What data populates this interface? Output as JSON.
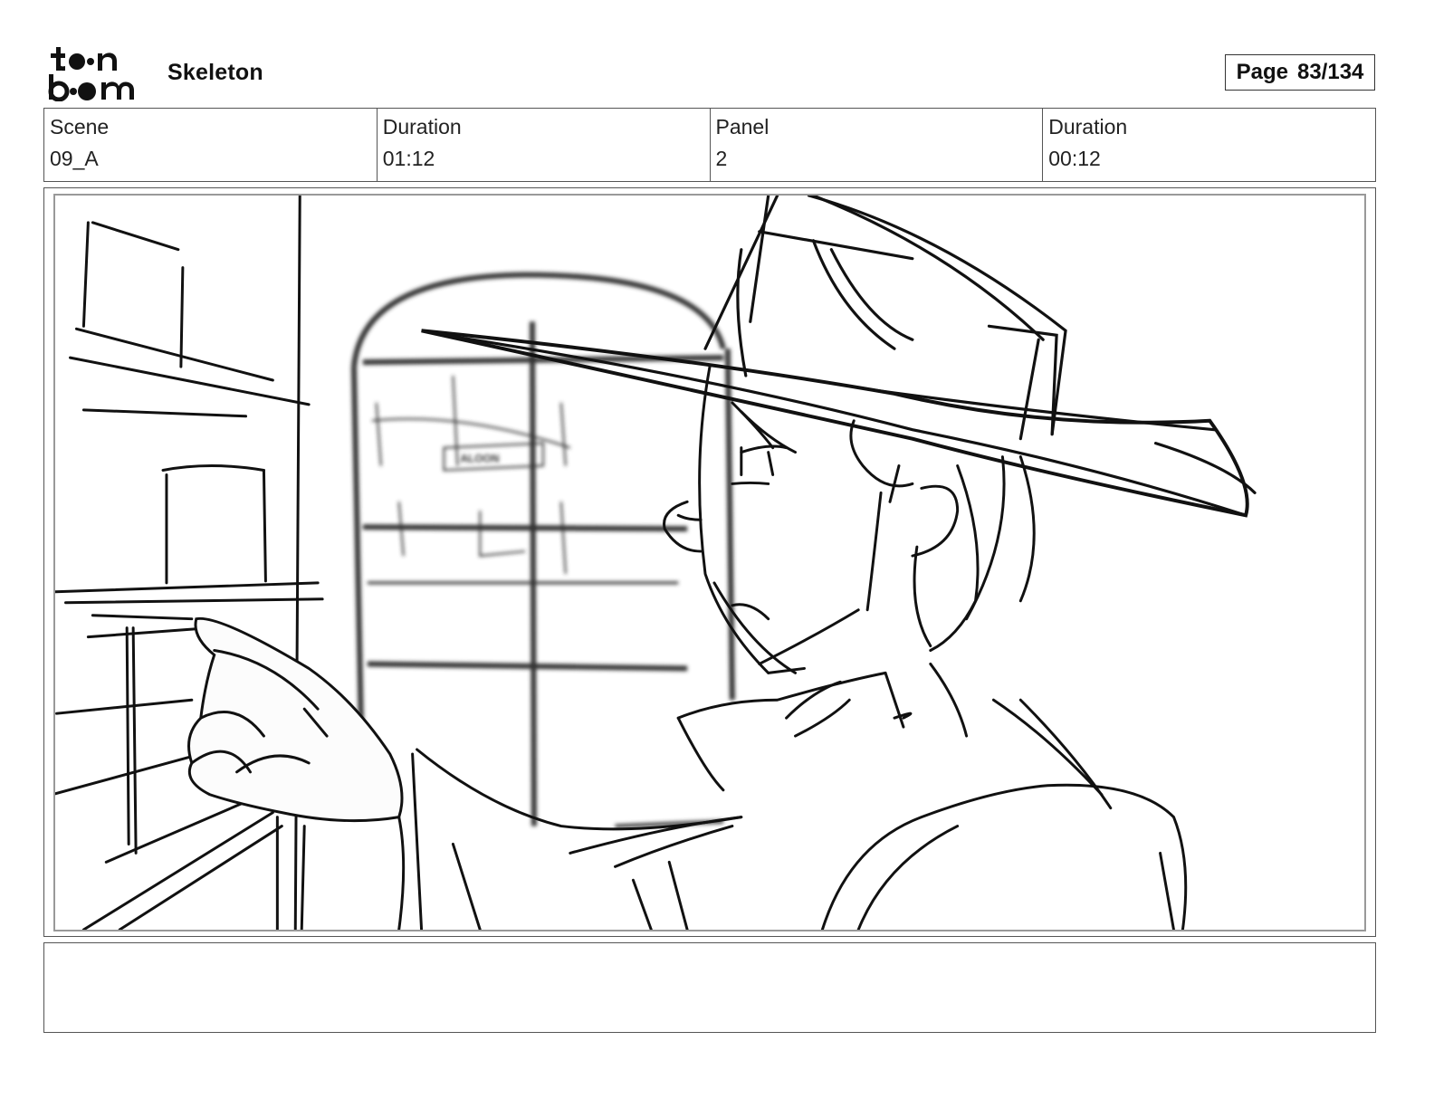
{
  "header": {
    "logo_name": "toon-boom-logo",
    "project_title": "Skeleton",
    "page_label": "Page",
    "page_number": "83/134"
  },
  "info": {
    "scene_label": "Scene",
    "scene_value": "09_A",
    "scene_duration_label": "Duration",
    "scene_duration_value": "01:12",
    "panel_label": "Panel",
    "panel_value": "2",
    "panel_duration_label": "Duration",
    "panel_duration_value": "00:12"
  },
  "panel": {
    "sketch_label": "ALOON"
  },
  "notes": {
    "text": ""
  }
}
